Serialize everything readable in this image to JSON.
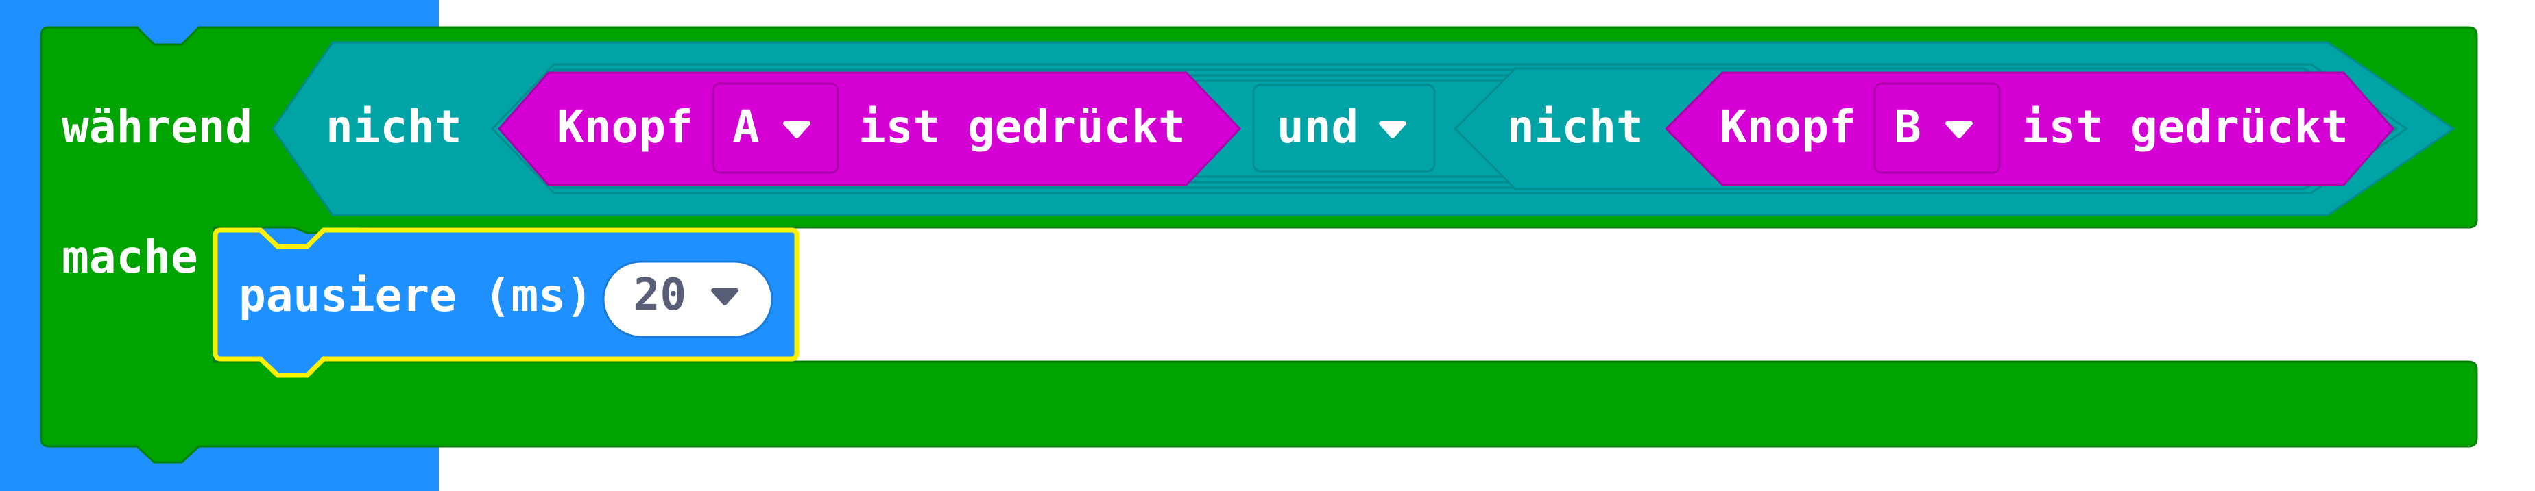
{
  "while_block": {
    "label": "während",
    "do_label": "mache",
    "colors": {
      "block": "#00A400",
      "stroke": "#008000"
    }
  },
  "outer_not": {
    "label": "nicht",
    "colors": {
      "block": "#00A4A6",
      "stroke": "#008C8E"
    }
  },
  "button_a": {
    "label": "Knopf",
    "value": "A",
    "suffix": "ist gedrückt",
    "colors": {
      "block": "#D400D4",
      "stroke": "#AA00AA"
    }
  },
  "and_op": {
    "value": "und"
  },
  "inner_not": {
    "label": "nicht"
  },
  "button_b": {
    "label": "Knopf",
    "value": "B",
    "suffix": "ist gedrückt"
  },
  "pause_block": {
    "label": "pausiere (ms)",
    "value": "20",
    "colors": {
      "block": "#1E90FF",
      "highlight": "#FFF200",
      "field": "#FFFFFF"
    }
  },
  "icons": {
    "dropdown": "caret-down-icon"
  },
  "colors": {
    "side_blue": "#1E90FF",
    "caret": "#FFFFFF",
    "num_caret": "#575E75"
  }
}
